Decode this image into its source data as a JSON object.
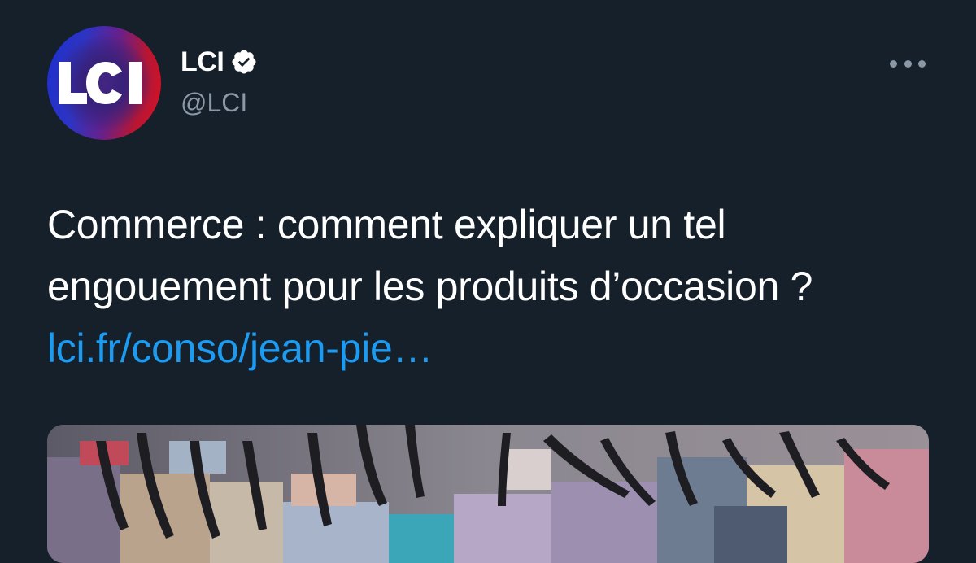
{
  "account": {
    "display_name": "LCI",
    "handle": "@LCI",
    "avatar_logo_text": "LCI",
    "verified_icon": "verified-badge-icon"
  },
  "tweet": {
    "text": "Commerce : comment expliquer un tel engouement pour les produits d’occasion ? ",
    "link_text": "lci.fr/conso/jean-pie…"
  },
  "menu": {
    "icon": "more-options-icon"
  },
  "colors": {
    "background": "#15202b",
    "primary_text": "#ffffff",
    "secondary_text": "#8b98a5",
    "link": "#1d9bf0"
  }
}
